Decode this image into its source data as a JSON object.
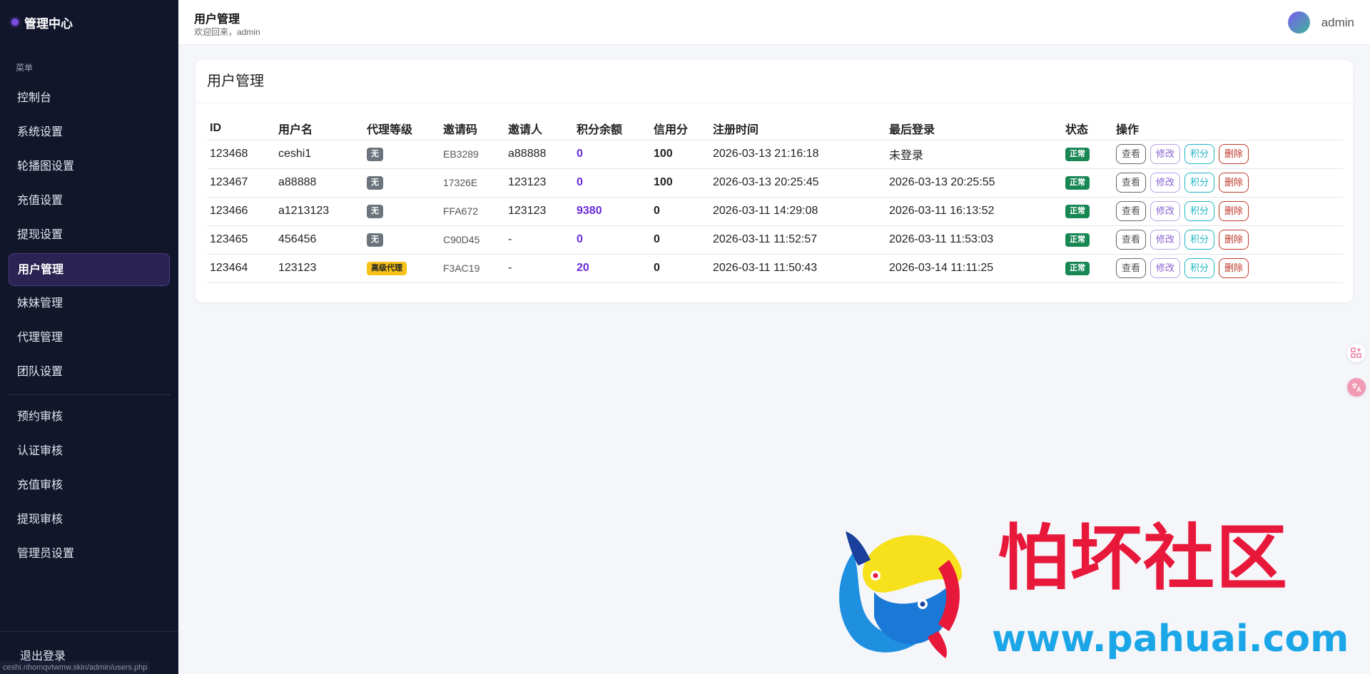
{
  "sidebar": {
    "brand": "管理中心",
    "section_label": "菜单",
    "items": [
      {
        "label": "控制台"
      },
      {
        "label": "系统设置"
      },
      {
        "label": "轮播图设置"
      },
      {
        "label": "充值设置"
      },
      {
        "label": "提现设置"
      },
      {
        "label": "用户管理",
        "active": true
      },
      {
        "label": "妹妹管理"
      },
      {
        "label": "代理管理"
      },
      {
        "label": "团队设置"
      }
    ],
    "items2": [
      {
        "label": "预约审核"
      },
      {
        "label": "认证审核"
      },
      {
        "label": "充值审核"
      },
      {
        "label": "提现审核"
      },
      {
        "label": "管理员设置"
      }
    ],
    "logout": "退出登录",
    "status_url": "ceshi.nhomqvtwmw.skin/admin/users.php"
  },
  "header": {
    "title": "用户管理",
    "subtitle": "欢迎回来，admin",
    "username": "admin"
  },
  "card": {
    "title": "用户管理",
    "columns": [
      "ID",
      "用户名",
      "代理等级",
      "邀请码",
      "邀请人",
      "积分余额",
      "信用分",
      "注册时间",
      "最后登录",
      "状态",
      "操作"
    ],
    "rows": [
      {
        "id": "123468",
        "username": "ceshi1",
        "level": "无",
        "code": "EB3289",
        "inviter": "a88888",
        "points": "0",
        "credit": "100",
        "reg_time": "2026-03-13 21:16:18",
        "last_login": "未登录",
        "status": "正常"
      },
      {
        "id": "123467",
        "username": "a88888",
        "level": "无",
        "code": "17326E",
        "inviter": "123123",
        "points": "0",
        "credit": "100",
        "reg_time": "2026-03-13 20:25:45",
        "last_login": "2026-03-13 20:25:55",
        "status": "正常"
      },
      {
        "id": "123466",
        "username": "a1213123",
        "level": "无",
        "code": "FFA672",
        "inviter": "123123",
        "points": "9380",
        "credit": "0",
        "reg_time": "2026-03-11 14:29:08",
        "last_login": "2026-03-11 16:13:52",
        "status": "正常"
      },
      {
        "id": "123465",
        "username": "456456",
        "level": "无",
        "code": "C90D45",
        "inviter": "-",
        "points": "0",
        "credit": "0",
        "reg_time": "2026-03-11 11:52:57",
        "last_login": "2026-03-11 11:53:03",
        "status": "正常"
      },
      {
        "id": "123464",
        "username": "123123",
        "level": "高级代理",
        "code": "F3AC19",
        "inviter": "-",
        "points": "20",
        "credit": "0",
        "reg_time": "2026-03-11 11:50:43",
        "last_login": "2026-03-14 11:11:25",
        "status": "正常"
      }
    ],
    "actions": {
      "view": "查看",
      "edit": "修改",
      "points": "积分",
      "delete": "删除"
    }
  },
  "watermark": {
    "text": "怕坏社区",
    "url": "www.pahuai.com"
  },
  "colors": {
    "sidebar_bg": "#12162b",
    "accent": "#6a2bd8",
    "status_ok": "#198754",
    "level_senior": "#f6c21a"
  }
}
